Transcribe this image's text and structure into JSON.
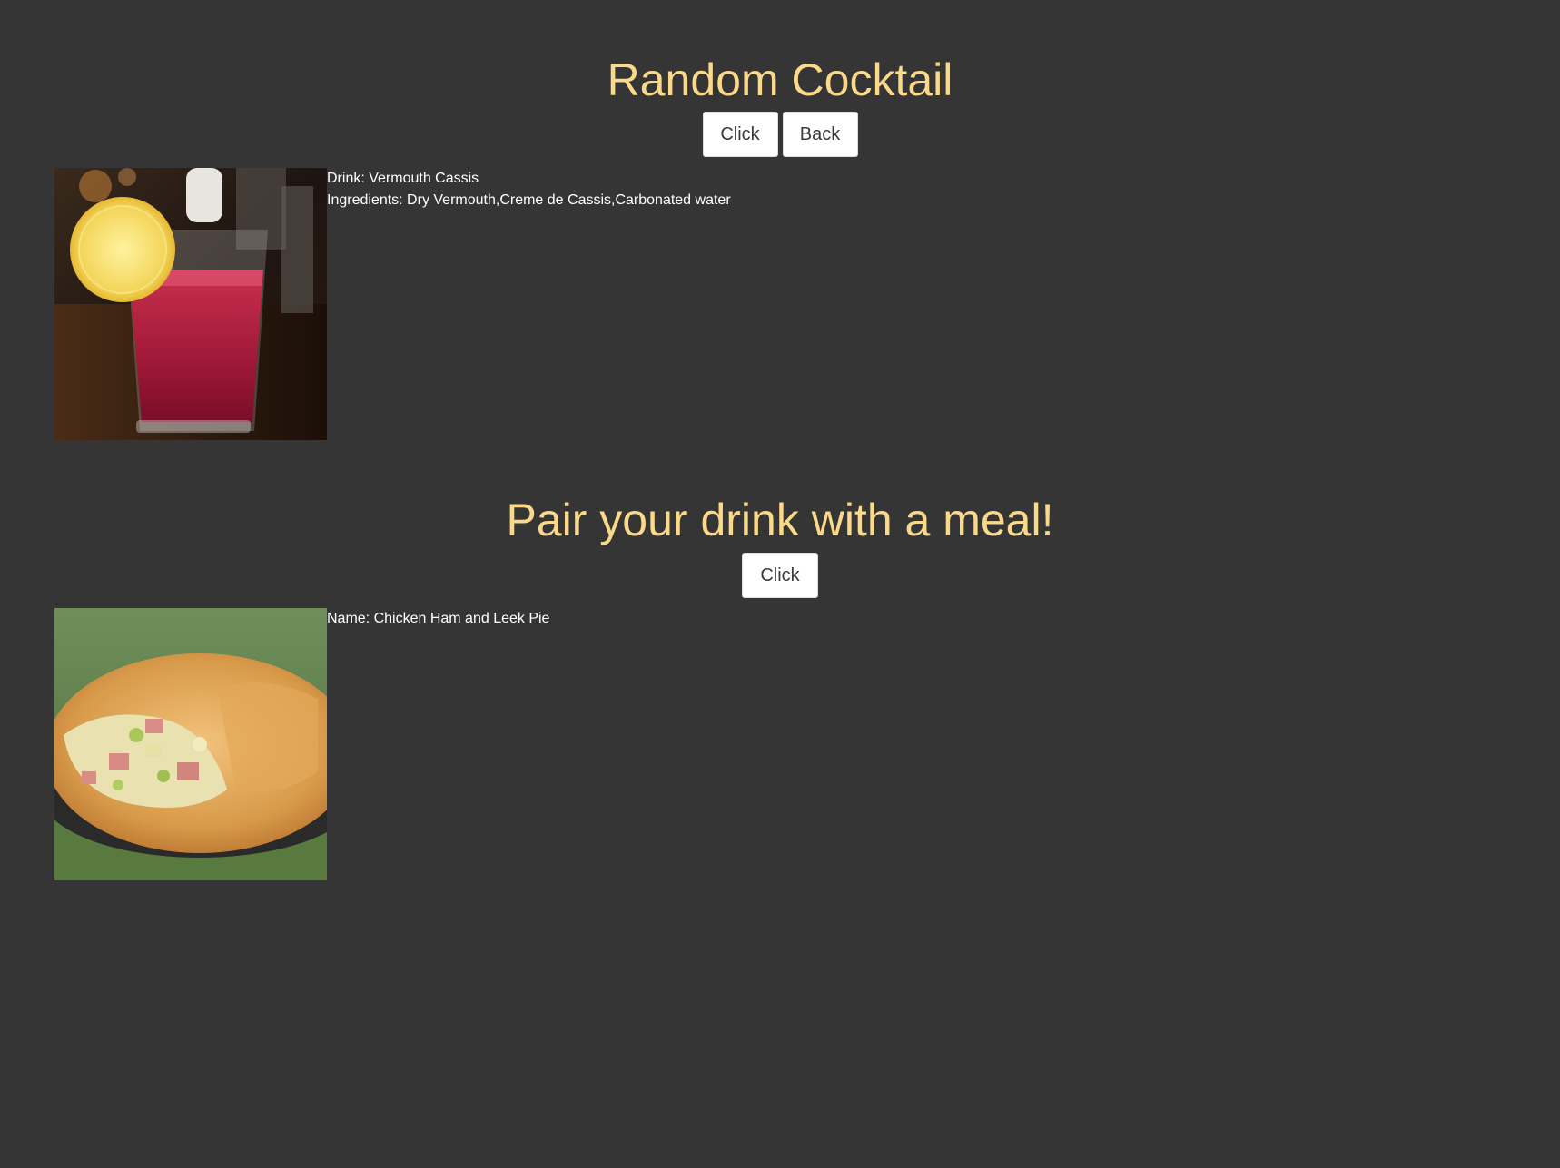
{
  "cocktail_section": {
    "title": "Random Cocktail",
    "click_label": "Click",
    "back_label": "Back",
    "drink_line": "Drink: Vermouth Cassis",
    "ingredients_line": "Ingredients: Dry Vermouth,Creme de Cassis,Carbonated water"
  },
  "meal_section": {
    "title": "Pair your drink with a meal!",
    "click_label": "Click",
    "name_line": "Name: Chicken Ham and Leek Pie"
  },
  "colors": {
    "background": "#353535",
    "heading": "#fad98b",
    "text": "#ffffff",
    "button_bg": "#ffffff"
  }
}
